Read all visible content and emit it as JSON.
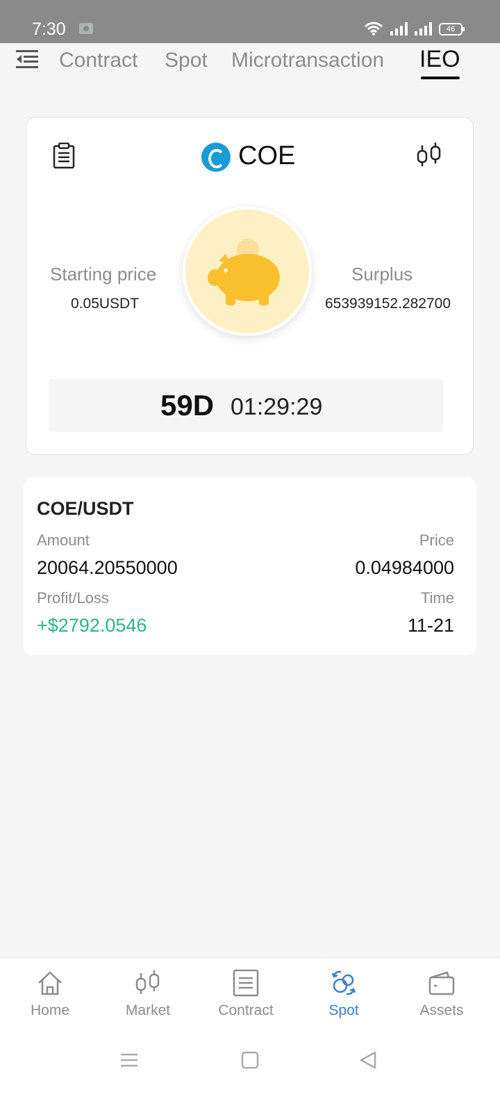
{
  "status_bar": {
    "time": "7:30",
    "battery": "46"
  },
  "tabs": [
    {
      "label": "Contract",
      "active": false
    },
    {
      "label": "Spot",
      "active": false
    },
    {
      "label": "Microtransaction",
      "active": false
    },
    {
      "label": "IEO",
      "active": true
    }
  ],
  "ieo": {
    "coin": "COE",
    "starting_price_label": "Starting price",
    "starting_price_value": "0.05USDT",
    "surplus_label": "Surplus",
    "surplus_value": "653939152.282700",
    "countdown_days": "59D",
    "countdown_time": "01:29:29"
  },
  "trade": {
    "pair": "COE/USDT",
    "amount_label": "Amount",
    "amount_value": "20064.20550000",
    "price_label": "Price",
    "price_value": "0.04984000",
    "pl_label": "Profit/Loss",
    "pl_value": "+$2792.0546",
    "time_label": "Time",
    "time_value": "11-21"
  },
  "bottom_nav": [
    {
      "label": "Home",
      "icon": "home-icon",
      "active": false
    },
    {
      "label": "Market",
      "icon": "candlestick-icon",
      "active": false
    },
    {
      "label": "Contract",
      "icon": "document-icon",
      "active": false
    },
    {
      "label": "Spot",
      "icon": "exchange-icon",
      "active": true
    },
    {
      "label": "Assets",
      "icon": "wallet-icon",
      "active": false
    }
  ],
  "colors": {
    "profit": "#2bb588",
    "active_nav": "#3d7ec8",
    "coin_logo": "#1a9ad6",
    "pig": "#fbc02d"
  }
}
